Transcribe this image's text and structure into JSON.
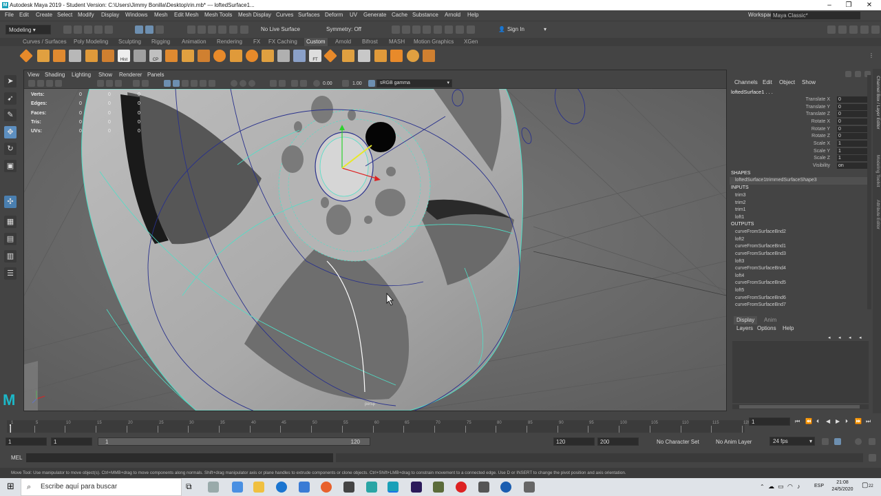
{
  "window": {
    "title": "Autodesk Maya 2019 - Student Version: C:\\Users\\Jimmy Bonilla\\Desktop\\rin.mb*   ---   loftedSurface1...",
    "controls": [
      "–",
      "❐",
      "✕"
    ]
  },
  "menu": {
    "items": [
      "File",
      "Edit",
      "Create",
      "Select",
      "Modify",
      "Display",
      "Windows",
      "Mesh",
      "Edit Mesh",
      "Mesh Tools",
      "Mesh Display",
      "Curves",
      "Surfaces",
      "Deform",
      "UV",
      "Generate",
      "Cache",
      "Substance",
      "Arnold",
      "Help"
    ],
    "workspace_label": "Workspace :",
    "workspace_value": "Maya Classic*"
  },
  "statusline": {
    "mode": "Modeling",
    "live_surface": "No Live Surface",
    "symmetry": "Symmetry: Off",
    "sign_in": "Sign In"
  },
  "shelf": {
    "tabs": [
      "Curves / Surfaces",
      "Poly Modeling",
      "Sculpting",
      "Rigging",
      "Animation",
      "Rendering",
      "FX",
      "FX Caching",
      "Custom",
      "Arnold",
      "Bifrost",
      "MASH",
      "Motion Graphics",
      "XGen"
    ],
    "active_tab": "Custom",
    "icon_labels": [
      "Hist",
      "CP",
      "FT"
    ]
  },
  "viewport": {
    "menu": [
      "View",
      "Shading",
      "Lighting",
      "Show",
      "Renderer",
      "Panels"
    ],
    "exposure": "0.00",
    "gamma": "1.00",
    "color_space": "sRGB gamma",
    "camera_label": "persp",
    "hud": [
      {
        "label": "Verts:",
        "values": [
          "0",
          "0",
          "0"
        ]
      },
      {
        "label": "Edges:",
        "values": [
          "0",
          "0",
          "0"
        ]
      },
      {
        "label": "Faces:",
        "values": [
          "0",
          "0",
          "0"
        ]
      },
      {
        "label": "Tris:",
        "values": [
          "0",
          "0",
          "0"
        ]
      },
      {
        "label": "UVs:",
        "values": [
          "0",
          "0",
          "0"
        ]
      }
    ]
  },
  "channelbox": {
    "menu": [
      "Channels",
      "Edit",
      "Object",
      "Show"
    ],
    "object_name": "loftedSurface1 . . .",
    "attributes": [
      {
        "name": "Translate X",
        "value": "0"
      },
      {
        "name": "Translate Y",
        "value": "0"
      },
      {
        "name": "Translate Z",
        "value": "0"
      },
      {
        "name": "Rotate X",
        "value": "0"
      },
      {
        "name": "Rotate Y",
        "value": "0"
      },
      {
        "name": "Rotate Z",
        "value": "0"
      },
      {
        "name": "Scale X",
        "value": "1"
      },
      {
        "name": "Scale Y",
        "value": "1"
      },
      {
        "name": "Scale Z",
        "value": "1"
      },
      {
        "name": "Visibility",
        "value": "on"
      }
    ],
    "shapes_header": "SHAPES",
    "shape": "loftedSurface1trimmedSurfaceShape3",
    "inputs_header": "INPUTS",
    "inputs": [
      "trim3",
      "trim2",
      "trim1",
      "loft1"
    ],
    "outputs_header": "OUTPUTS",
    "outputs": [
      "curveFromSurfaceBnd2",
      "loft2",
      "curveFromSurfaceBnd1",
      "curveFromSurfaceBnd3",
      "loft3",
      "curveFromSurfaceBnd4",
      "loft4",
      "curveFromSurfaceBnd5",
      "loft5",
      "curveFromSurfaceBnd6",
      "curveFromSurfaceBnd7"
    ]
  },
  "layereditor": {
    "tabs": [
      "Display",
      "Anim"
    ],
    "menu": [
      "Layers",
      "Options",
      "Help"
    ]
  },
  "sidetabs": [
    "Channel Box / Layer Editor",
    "Modeling Toolkit",
    "Attribute Editor"
  ],
  "timeline": {
    "ticks": [
      "1",
      "5",
      "10",
      "15",
      "20",
      "25",
      "30",
      "35",
      "40",
      "45",
      "50",
      "55",
      "60",
      "65",
      "70",
      "75",
      "80",
      "85",
      "90",
      "95",
      "100",
      "105",
      "110",
      "115",
      "120"
    ],
    "current_frame": "1"
  },
  "range": {
    "start": "1",
    "inner_start": "1",
    "slider_start": "1",
    "slider_end": "120",
    "end": "120",
    "max": "200",
    "character_set": "No Character Set",
    "anim_layer": "No Anim Layer",
    "fps": "24 fps"
  },
  "cmdline": {
    "label": "MEL"
  },
  "helpline": "Move Tool: Use manipulator to move object(s). Ctrl+MMB+drag to move components along normals. Shift+drag manipulator axis or plane handles to extrude components or clone objects. Ctrl+Shift+LMB+drag to constrain movement to a connected edge. Use D or INSERT to change the pivot position and axis orientation.",
  "taskbar": {
    "search_placeholder": "Escribe aquí para buscar",
    "lang": "ESP",
    "time": "21:08",
    "date": "24/5/2020",
    "notification_count": "22"
  },
  "colors": {
    "wireframe": "#4fe0c8",
    "curve": "#28308c",
    "viewport_bg": "#6c6c6c"
  }
}
